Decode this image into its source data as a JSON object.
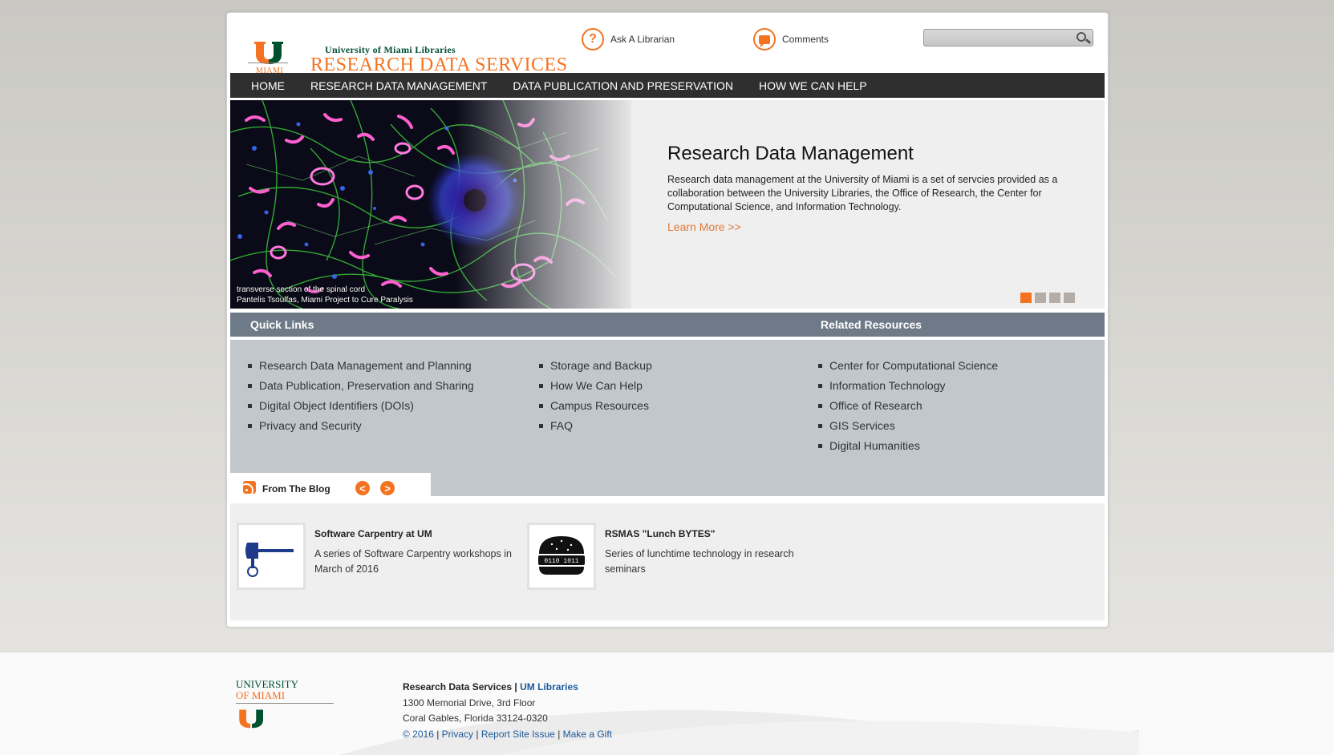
{
  "header": {
    "logo_sub": "University of Miami Libraries",
    "logo_title": "RESEARCH DATA SERVICES",
    "logo_miami": "MIAMI",
    "ask_librarian": "Ask A Librarian",
    "comments": "Comments",
    "search_placeholder": ""
  },
  "nav": {
    "items": [
      "HOME",
      "RESEARCH DATA MANAGEMENT",
      "DATA PUBLICATION AND PRESERVATION",
      "HOW WE CAN HELP"
    ]
  },
  "hero": {
    "caption_line1": "transverse section of the spinal cord",
    "caption_line2": "Pantelis Tsoulfas, Miami Project to Cure Paralysis",
    "title": "Research Data Management",
    "text": "Research data management at the University of Miami is a set of servcies provided as a collaboration between the University Libraries, the Office of Research, the Center for Computational Science, and Information Technology.",
    "learn_more": "Learn More >>",
    "slide_count": 4,
    "active_slide": 1
  },
  "quick_links": {
    "header": "Quick Links",
    "col1": [
      "Research Data Management and Planning",
      "Data Publication, Preservation and Sharing",
      "Digital Object Identifiers (DOIs)",
      "Privacy and Security"
    ],
    "col2": [
      "Storage and Backup",
      "How We Can Help",
      "Campus Resources",
      "FAQ"
    ]
  },
  "related": {
    "header": "Related Resources",
    "items": [
      "Center for Computational Science",
      "Information Technology",
      "Office of Research",
      "GIS Services",
      "Digital Humanities"
    ]
  },
  "blog": {
    "title": "From The Blog",
    "prev": "<",
    "next": ">",
    "posts": [
      {
        "title": "Software Carpentry at UM",
        "text": "A series of Software Carpentry workshops in March of 2016",
        "icon": "hammer-icon"
      },
      {
        "title": "RSMAS \"Lunch BYTES\"",
        "text": "Series of lunchtime technology in research seminars",
        "icon": "burger-icon",
        "bun_text": "0110 1011"
      }
    ]
  },
  "footer": {
    "logo_line1": "UNIVERSITY",
    "logo_line2": "OF MIAMI",
    "org": "Research Data Services",
    "sep": " | ",
    "org_link": "UM Libraries",
    "address1": "1300 Memorial Drive, 3rd Floor",
    "address2": "Coral Gables, Florida 33124-0320",
    "copyright": "© 2016",
    "privacy": "Privacy",
    "report": "Report Site Issue",
    "gift": "Make a Gift"
  },
  "colors": {
    "brand_orange": "#f47321",
    "brand_green": "#005030",
    "nav_bg": "#2f2f2f",
    "panel_header": "#6e7a88",
    "panel_body": "#c2c7cd"
  }
}
